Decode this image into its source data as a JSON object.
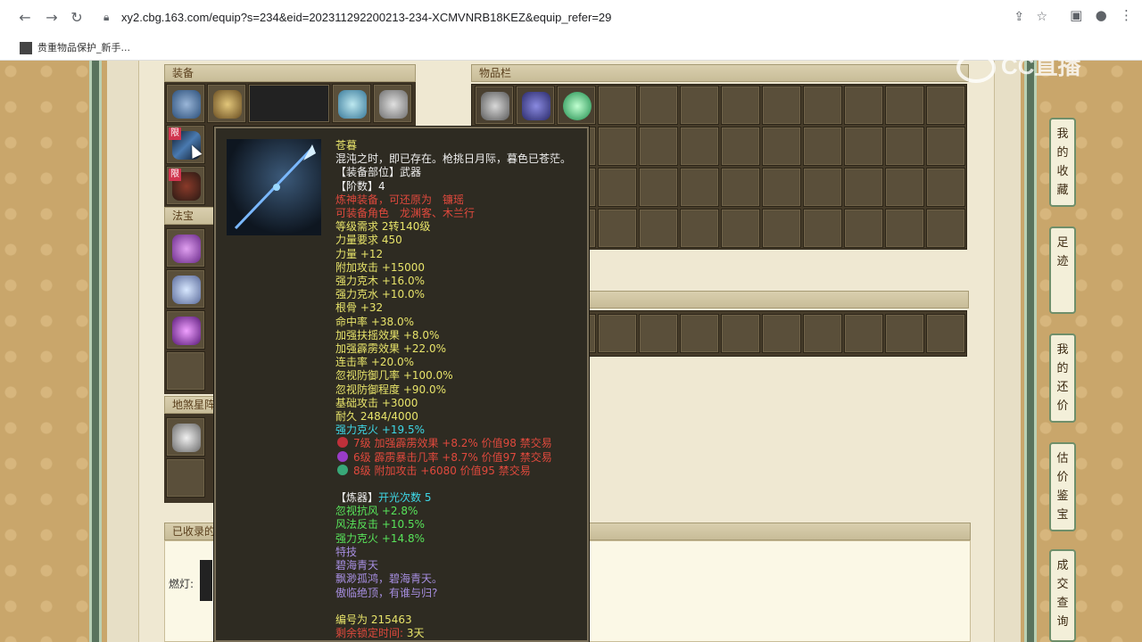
{
  "browser": {
    "url": "xy2.cbg.163.com/equip?s=234&eid=202311292200213-234-XCMVNRB18KEZ&equip_refer=29",
    "bookmark_label": "贵重物品保护_新手..."
  },
  "panels": {
    "equipment": "装备",
    "inventory": "物品栏",
    "fabao": "法宝",
    "disha": "地煞星阵",
    "collected": "已收录的",
    "lamp_label": "燃灯:"
  },
  "limit_badge": "限",
  "tooltip": {
    "name": "苍暮",
    "desc": "混沌之时，即已存在。枪挑日月际，暮色已苍茫。",
    "slot": "【装备部位】武器",
    "tier": "【阶数】4",
    "red_note1": "炼神装备，可还原为　镰瑶",
    "red_note2": "可装备角色　龙渊客、木兰行",
    "stats_yellow": [
      "等级需求 2转140级",
      "力量要求 450",
      "力量 +12",
      "附加攻击 +15000",
      "强力克木 +16.0%",
      "强力克水 +10.0%",
      "根骨 +32",
      "命中率 +38.0%",
      "加强扶摇效果 +8.0%",
      "加强霹雳效果 +22.0%",
      "连击率 +20.0%",
      "忽视防御几率 +100.0%",
      "忽视防御程度 +90.0%",
      "基础攻击 +3000",
      "耐久 2484/4000"
    ],
    "stat_cyan": "强力克火 +19.5%",
    "gems": [
      {
        "text": "7级 加强霹雳效果 +8.2% 价值98 禁交易",
        "color": "#c0303a"
      },
      {
        "text": "6级 霹雳暴击几率 +8.7% 价值97 禁交易",
        "color": "#9a3cc8"
      },
      {
        "text": "8级 附加攻击 +6080 价值95 禁交易",
        "color": "#38a878"
      }
    ],
    "refine_label": "【炼器】",
    "refine_count": "开光次数 5",
    "refine_stats": [
      "忽视抗风 +2.8%",
      "风法反击 +10.5%",
      "强力克火 +14.8%"
    ],
    "special": [
      "特技",
      "碧海青天",
      "飘渺孤鸿，碧海青天。",
      "傲临绝顶，有谁与归?"
    ],
    "serial": "编号为 215463",
    "bottom_red": "剩余锁定时间:",
    "bottom_days": "3天"
  },
  "sidebar": [
    {
      "label": "我的收藏"
    },
    {
      "label": "足迹"
    },
    {
      "label": "我的还价"
    },
    {
      "label": "估价鉴宝"
    },
    {
      "label": "成交查询"
    }
  ],
  "watermark": "CC直播"
}
